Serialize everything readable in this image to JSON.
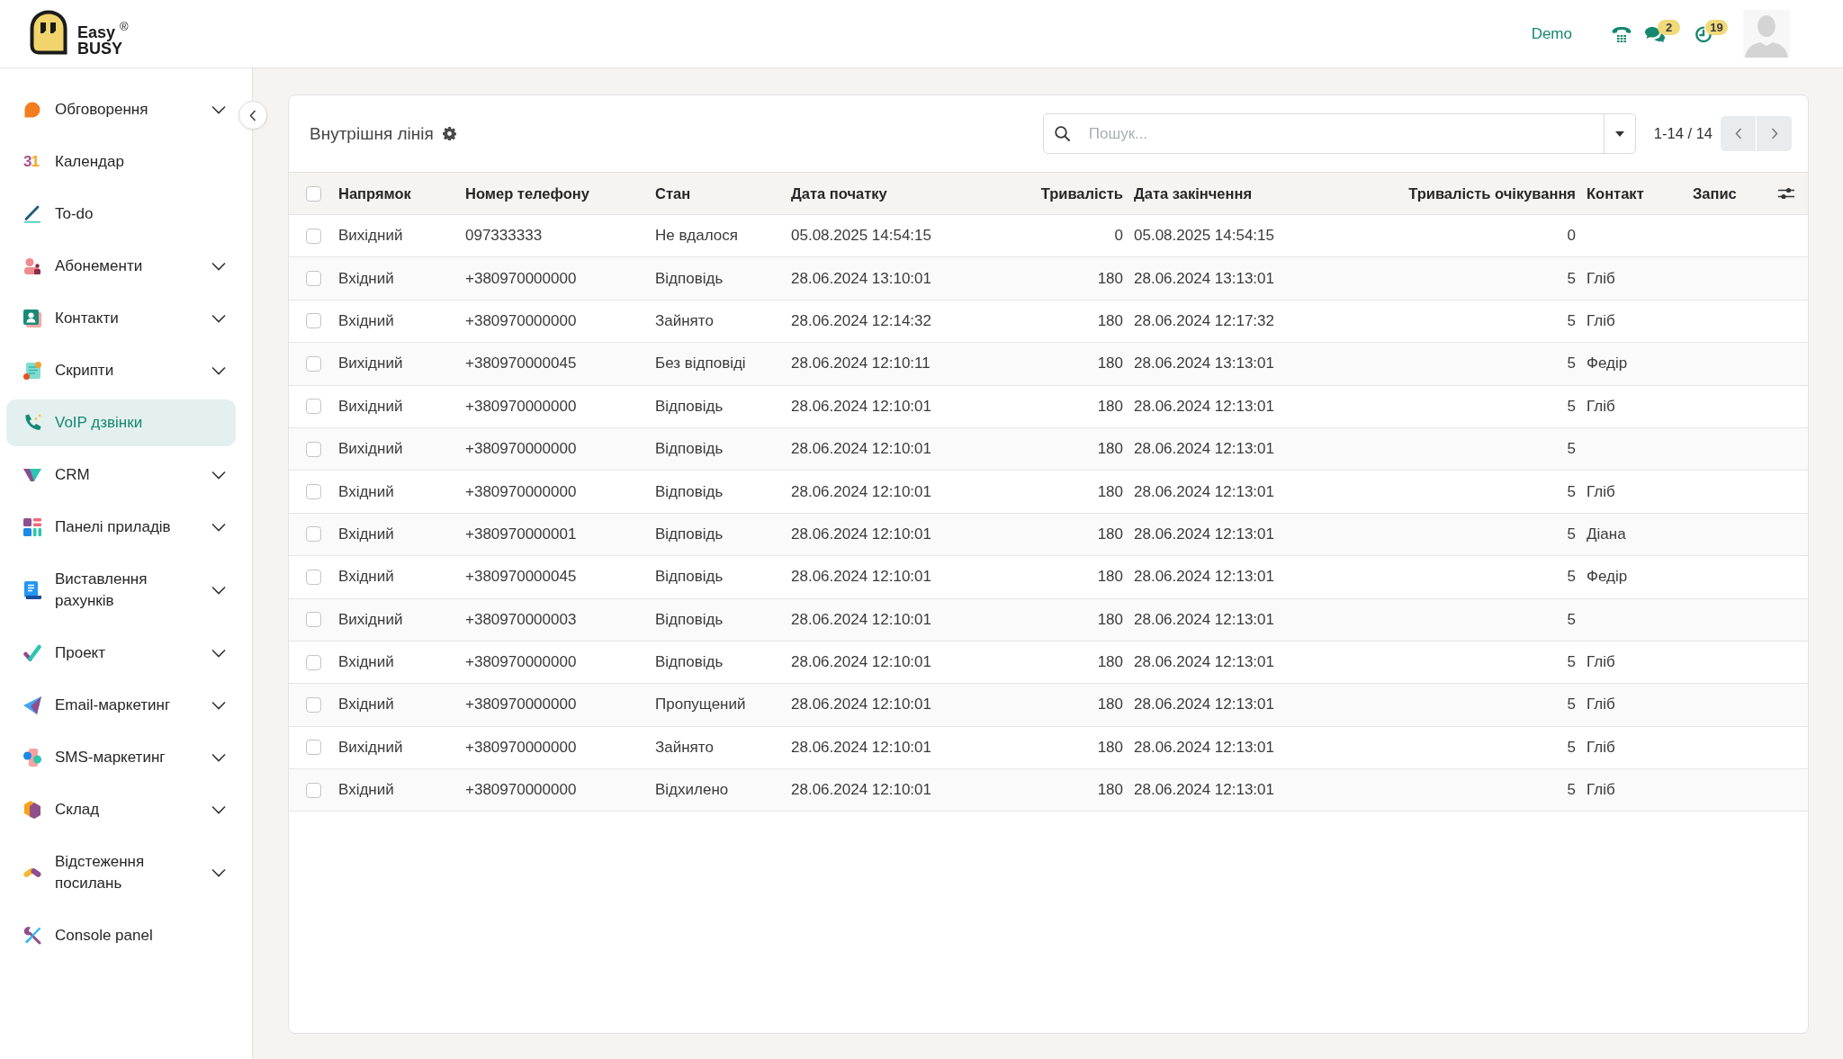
{
  "logo": {
    "line1": "Easy",
    "line2": "BUSY",
    "mark": "®"
  },
  "header": {
    "account": "Demo",
    "icons": [
      {
        "kind": "phone"
      },
      {
        "kind": "chat",
        "count": "2"
      },
      {
        "kind": "clock",
        "count": "19"
      }
    ]
  },
  "sidebar": {
    "items": [
      {
        "label": "Обговорення",
        "expandable": true,
        "selected": false
      },
      {
        "label": "Календар",
        "icon_text": "31",
        "expandable": false,
        "selected": false
      },
      {
        "label": "To-do",
        "expandable": false,
        "selected": false
      },
      {
        "label": "Абонементи",
        "expandable": true,
        "selected": false
      },
      {
        "label": "Контакти",
        "expandable": true,
        "selected": false
      },
      {
        "label": "Скрипти",
        "expandable": true,
        "selected": false
      },
      {
        "label": "VoIP дзвінки",
        "expandable": false,
        "selected": true
      },
      {
        "label": "CRM",
        "expandable": true,
        "selected": false
      },
      {
        "label": "Панелі приладів",
        "expandable": true,
        "selected": false
      },
      {
        "label": "Виставлення рахунків",
        "expandable": true,
        "selected": false
      },
      {
        "label": "Проект",
        "expandable": true,
        "selected": false
      },
      {
        "label": "Email-маркетинг",
        "expandable": true,
        "selected": false
      },
      {
        "label": "SMS-маркетинг",
        "expandable": true,
        "selected": false
      },
      {
        "label": "Склад",
        "expandable": true,
        "selected": false
      },
      {
        "label": "Відстеження посилань",
        "expandable": true,
        "selected": false
      },
      {
        "label": "Console panel",
        "expandable": false,
        "selected": false
      }
    ]
  },
  "card": {
    "title": "Внутрішня лінія",
    "search": {
      "placeholder": "Пошук..."
    },
    "pagination": "1-14 / 14"
  },
  "table": {
    "select_all": {
      "checked": false
    },
    "columns": [
      "Напрямок",
      "Номер телефону",
      "Стан",
      "Дата початку",
      "Тривалість",
      "Дата закінчення",
      "Тривалість очікування",
      "Контакт",
      "Запис"
    ],
    "rows": [
      {
        "checked": false,
        "direction": "Вихідний",
        "phone": "097333333",
        "status": "Не вдалося",
        "start": "05.08.2025 14:54:15",
        "duration": "0",
        "end": "05.08.2025 14:54:15",
        "wait": "0"
      },
      {
        "checked": false,
        "direction": "Вхідний",
        "phone": "+380970000000",
        "status": "Відповідь",
        "start": "28.06.2024 13:10:01",
        "duration": "180",
        "end": "28.06.2024 13:13:01",
        "wait": "5",
        "contact": "Гліб"
      },
      {
        "checked": false,
        "direction": "Вхідний",
        "phone": "+380970000000",
        "status": "Зайнято",
        "start": "28.06.2024 12:14:32",
        "duration": "180",
        "end": "28.06.2024 12:17:32",
        "wait": "5",
        "contact": "Гліб"
      },
      {
        "checked": false,
        "direction": "Вихідний",
        "phone": "+380970000045",
        "status": "Без відповіді",
        "start": "28.06.2024 12:10:11",
        "duration": "180",
        "end": "28.06.2024 13:13:01",
        "wait": "5",
        "contact": "Федір"
      },
      {
        "checked": false,
        "direction": "Вихідний",
        "phone": "+380970000000",
        "status": "Відповідь",
        "start": "28.06.2024 12:10:01",
        "duration": "180",
        "end": "28.06.2024 12:13:01",
        "wait": "5",
        "contact": "Гліб"
      },
      {
        "checked": false,
        "direction": "Вихідний",
        "phone": "+380970000000",
        "status": "Відповідь",
        "start": "28.06.2024 12:10:01",
        "duration": "180",
        "end": "28.06.2024 12:13:01",
        "wait": "5"
      },
      {
        "checked": false,
        "direction": "Вхідний",
        "phone": "+380970000000",
        "status": "Відповідь",
        "start": "28.06.2024 12:10:01",
        "duration": "180",
        "end": "28.06.2024 12:13:01",
        "wait": "5",
        "contact": "Гліб"
      },
      {
        "checked": false,
        "direction": "Вхідний",
        "phone": "+380970000001",
        "status": "Відповідь",
        "start": "28.06.2024 12:10:01",
        "duration": "180",
        "end": "28.06.2024 12:13:01",
        "wait": "5",
        "contact": "Діана"
      },
      {
        "checked": false,
        "direction": "Вхідний",
        "phone": "+380970000045",
        "status": "Відповідь",
        "start": "28.06.2024 12:10:01",
        "duration": "180",
        "end": "28.06.2024 12:13:01",
        "wait": "5",
        "contact": "Федір"
      },
      {
        "checked": false,
        "direction": "Вихідний",
        "phone": "+380970000003",
        "status": "Відповідь",
        "start": "28.06.2024 12:10:01",
        "duration": "180",
        "end": "28.06.2024 12:13:01",
        "wait": "5"
      },
      {
        "checked": false,
        "direction": "Вхідний",
        "phone": "+380970000000",
        "status": "Відповідь",
        "start": "28.06.2024 12:10:01",
        "duration": "180",
        "end": "28.06.2024 12:13:01",
        "wait": "5",
        "contact": "Гліб"
      },
      {
        "checked": false,
        "direction": "Вхідний",
        "phone": "+380970000000",
        "status": "Пропущений",
        "start": "28.06.2024 12:10:01",
        "duration": "180",
        "end": "28.06.2024 12:13:01",
        "wait": "5",
        "contact": "Гліб"
      },
      {
        "checked": false,
        "direction": "Вихідний",
        "phone": "+380970000000",
        "status": "Зайнято",
        "start": "28.06.2024 12:10:01",
        "duration": "180",
        "end": "28.06.2024 12:13:01",
        "wait": "5",
        "contact": "Гліб"
      },
      {
        "checked": false,
        "direction": "Вхідний",
        "phone": "+380970000000",
        "status": "Відхилено",
        "start": "28.06.2024 12:10:01",
        "duration": "180",
        "end": "28.06.2024 12:13:01",
        "wait": "5",
        "contact": "Гліб"
      }
    ]
  }
}
